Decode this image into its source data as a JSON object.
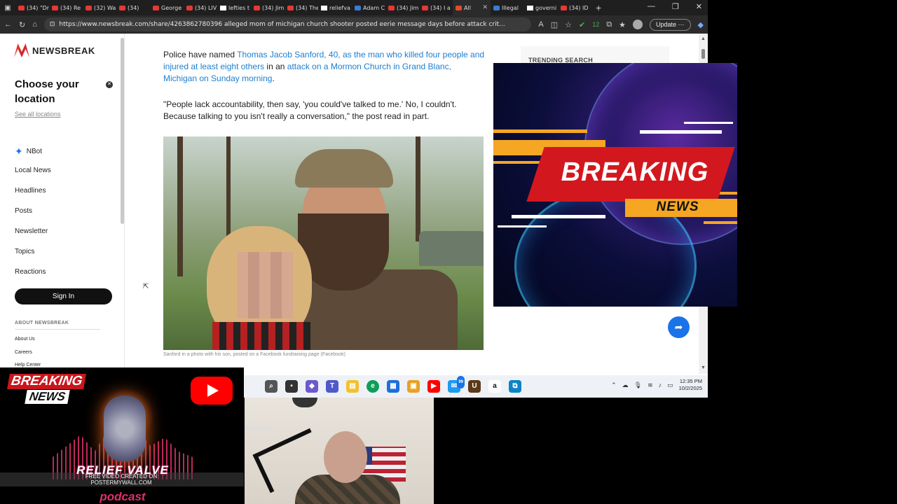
{
  "browser": {
    "tabs": [
      {
        "label": "(34) \"Dr",
        "icon": "youtube-icon"
      },
      {
        "label": "(34) Re",
        "icon": "youtube-icon"
      },
      {
        "label": "(32) Wa",
        "icon": "youtube-icon"
      },
      {
        "label": "(34)",
        "icon": "youtube-icon"
      },
      {
        "label": "George",
        "icon": "news-icon"
      },
      {
        "label": "(34) LIV",
        "icon": "youtube-icon"
      },
      {
        "label": "lefties t",
        "icon": "x-icon"
      },
      {
        "label": "(34) Jim",
        "icon": "youtube-icon"
      },
      {
        "label": "(34) The",
        "icon": "youtube-icon"
      },
      {
        "label": "reliefva",
        "icon": "x-icon"
      },
      {
        "label": "Adam C",
        "icon": "site-icon"
      },
      {
        "label": "(34) Jim",
        "icon": "youtube-icon"
      },
      {
        "label": "(34) I a",
        "icon": "youtube-icon"
      },
      {
        "label": "All",
        "icon": "newsbreak-icon",
        "active": true
      },
      {
        "label": "Illegal",
        "icon": "site-icon"
      },
      {
        "label": "governi",
        "icon": "x-icon"
      },
      {
        "label": "(34) ID",
        "icon": "youtube-icon"
      }
    ],
    "url": "https://www.newsbreak.com/share/4263862780396 alleged mom of michigan church shooter posted eerie message days before attack crit...",
    "update_label": "Update",
    "extension_badge": "12"
  },
  "sidebar": {
    "logo_text": "NEWSBREAK",
    "location_title": "Choose your location",
    "location_link": "See all locations",
    "nav": [
      {
        "label": "NBot"
      },
      {
        "label": "Local News"
      },
      {
        "label": "Headlines"
      },
      {
        "label": "Posts"
      },
      {
        "label": "Newsletter"
      },
      {
        "label": "Topics"
      },
      {
        "label": "Reactions"
      }
    ],
    "signin_label": "Sign In",
    "about_heading": "ABOUT NEWSBREAK",
    "about_links": [
      "About Us",
      "Careers",
      "Help Center"
    ]
  },
  "article": {
    "p1_pre": "Police have named ",
    "p1_link1": "Thomas Jacob Sanford, 40, as the man who killed four people and injured at least eight others",
    "p1_mid": " in an ",
    "p1_link2": "attack on a Mormon Church in Grand Blanc, Michigan on Sunday morning",
    "p1_end": ".",
    "quote": "\"People lack accountability, then say, 'you could've talked to me.' No, I couldn't. Because talking to you isn't really a conversation,\" the post read in part.",
    "caption": "Sanford in a photo with his son, posted on a Facebook fundraising page (Facebook)"
  },
  "right_rail": {
    "trending_label": "TRENDING SEARCH"
  },
  "overlay": {
    "breaking": "BREAKING",
    "news": "NEWS"
  },
  "podcast": {
    "breaking": "BREAKING",
    "news": "NEWS",
    "brand": "RELIEF VALVE",
    "watermark1": "FREE VIDEO CREATED ON",
    "watermark2": "POSTERMYWALL.COM",
    "brand2": "podcast"
  },
  "taskbar": {
    "time": "12:35 PM",
    "date": "10/2/2025",
    "badge": "99"
  },
  "colors": {
    "link": "#1e7ecf",
    "brand_red": "#d3171e",
    "accent_orange": "#f5a623",
    "share_blue": "#1a73e8"
  }
}
